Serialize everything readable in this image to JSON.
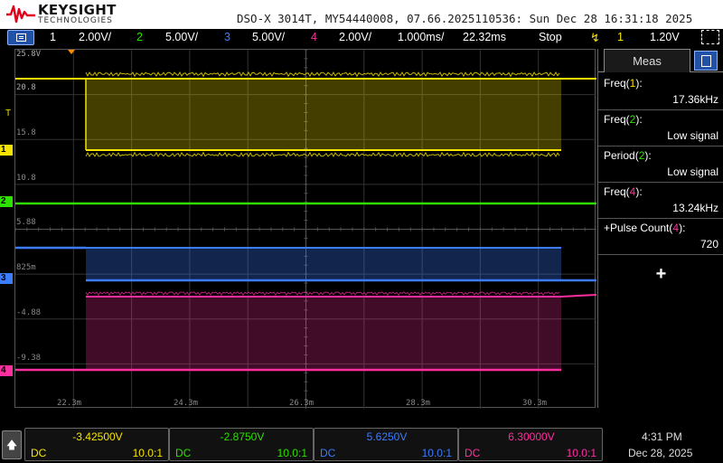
{
  "header": {
    "brand": "KEYSIGHT",
    "brand_sub": "TECHNOLOGIES",
    "scope_info": "DSO-X 3014T, MY54440008, 07.66.2025110536: Sun Dec 28 16:31:18 2025"
  },
  "channel_bar": {
    "ch1_num": "1",
    "ch1_scale": "2.00V/",
    "ch2_num": "2",
    "ch2_scale": "5.00V/",
    "ch3_num": "3",
    "ch3_scale": "5.00V/",
    "ch4_num": "4",
    "ch4_scale": "2.00V/",
    "timebase": "1.000ms/",
    "delay": "22.32ms",
    "run_state": "Stop",
    "trig_source": "1",
    "trig_level": "1.20V"
  },
  "grid": {
    "y_labels": [
      "25.8V",
      "20.8",
      "15.8",
      "10.8",
      "5.88",
      "825m",
      "-4.88",
      "-9.38"
    ],
    "x_labels": [
      "22.3m",
      "24.3m",
      "26.3m",
      "28.3m",
      "30.3m"
    ]
  },
  "markers": {
    "trig_marker": "T",
    "ch1": "1",
    "ch2": "2",
    "ch3": "3",
    "ch4": "4"
  },
  "meas_panel": {
    "tab_label": "Meas",
    "rows": [
      {
        "name_pre": "Freq(",
        "ch": "1",
        "name_post": "):",
        "value": "17.36kHz",
        "color": "#f5e400"
      },
      {
        "name_pre": "Freq(",
        "ch": "2",
        "name_post": "):",
        "value": "Low signal",
        "color": "#2ee000"
      },
      {
        "name_pre": "Period(",
        "ch": "2",
        "name_post": "):",
        "value": "Low signal",
        "color": "#2ee000"
      },
      {
        "name_pre": "Freq(",
        "ch": "4",
        "name_post": "):",
        "value": "13.24kHz",
        "color": "#ff2fa0"
      },
      {
        "name_pre": "+Pulse Count(",
        "ch": "4",
        "name_post": "):",
        "value": "720",
        "color": "#ff2fa0"
      }
    ],
    "add_label": "+"
  },
  "bottom": {
    "cards": [
      {
        "offset": "-3.42500V",
        "coupling": "DC",
        "probe": "10.0:1",
        "color": "#f5e400"
      },
      {
        "offset": "-2.8750V",
        "coupling": "DC",
        "probe": "10.0:1",
        "color": "#2ee000"
      },
      {
        "offset": "5.6250V",
        "coupling": "DC",
        "probe": "10.0:1",
        "color": "#3c7cff"
      },
      {
        "offset": "6.30000V",
        "coupling": "DC",
        "probe": "10.0:1",
        "color": "#ff2fa0"
      }
    ],
    "time": "4:31 PM",
    "date": "Dec 28, 2025"
  },
  "colors": {
    "ch1": "#f5e400",
    "ch2": "#2ee000",
    "ch3": "#3c7cff",
    "ch4": "#ff2fa0",
    "accent": "#2251a8"
  }
}
